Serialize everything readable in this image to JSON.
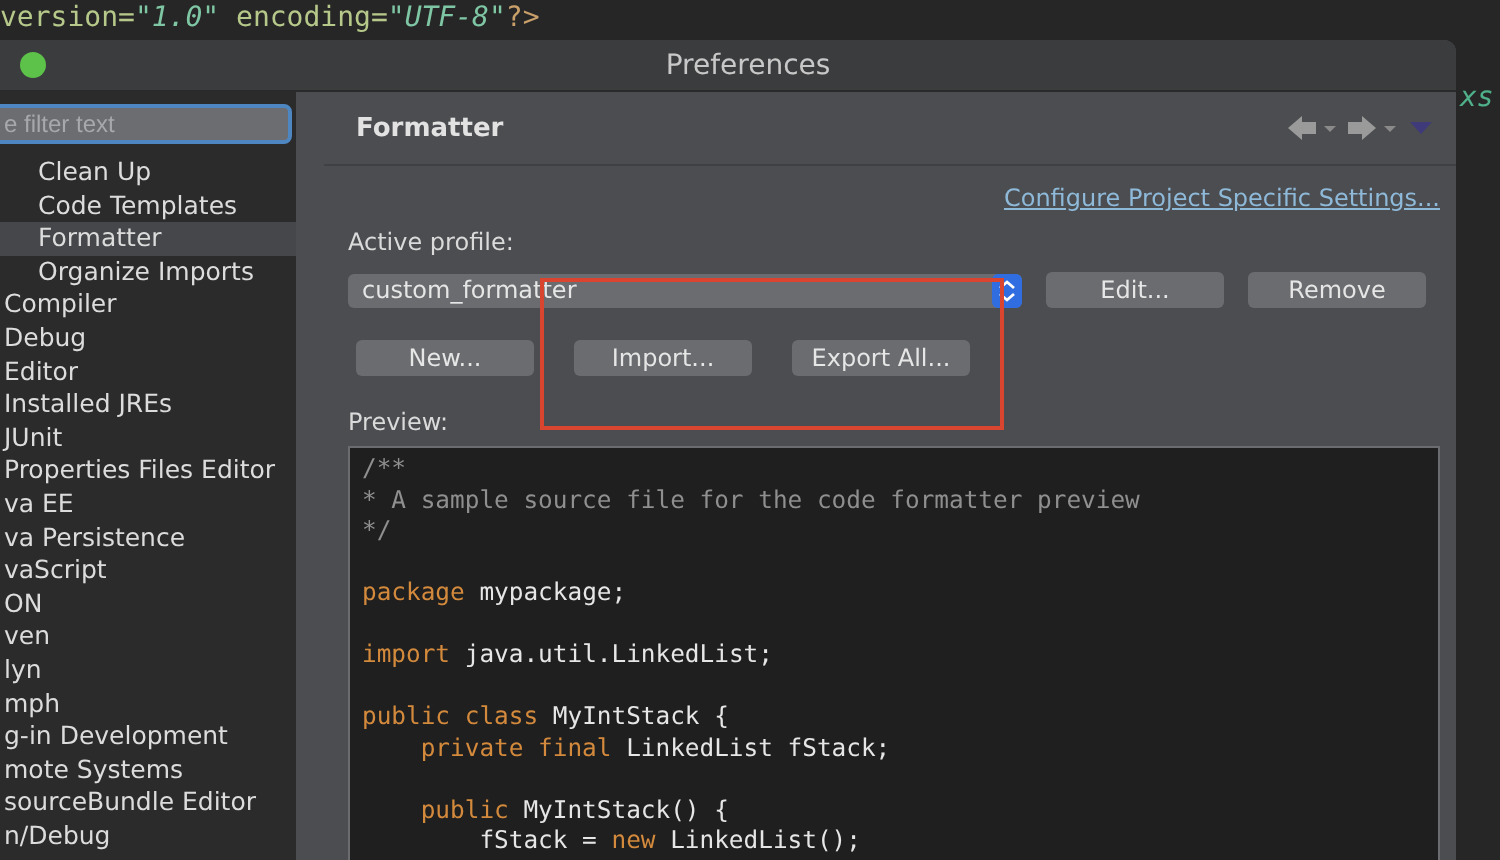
{
  "editor_line": [
    {
      "kind": "attr",
      "text": "version="
    },
    {
      "kind": "string",
      "text": "\"1.0\""
    },
    {
      "kind": "attr",
      "text": " encoding="
    },
    {
      "kind": "string",
      "text": "\"UTF-8\""
    },
    {
      "kind": "tag",
      "text": "?>"
    }
  ],
  "editor_side_text": "xs",
  "window": {
    "title": "Preferences"
  },
  "sidebar": {
    "filter": {
      "placeholder": "e filter text"
    },
    "subitems": [
      {
        "label": "Clean Up",
        "selected": false
      },
      {
        "label": "Code Templates",
        "selected": false
      },
      {
        "label": "Formatter",
        "selected": true
      },
      {
        "label": "Organize Imports",
        "selected": false
      }
    ],
    "items": [
      "Compiler",
      "Debug",
      "Editor",
      "Installed JREs",
      "JUnit",
      "Properties Files Editor",
      "va EE",
      "va Persistence",
      "vaScript",
      "ON",
      "ven",
      "lyn",
      "mph",
      "g-in Development",
      "mote Systems",
      "sourceBundle Editor",
      "n/Debug"
    ]
  },
  "page": {
    "title": "Formatter",
    "link": "Configure Project Specific Settings...",
    "profile_label": "Active profile:",
    "profile_value": "custom_formatter",
    "side_buttons": [
      "Edit...",
      "Remove"
    ],
    "buttons": [
      "New...",
      "Import...",
      "Export All..."
    ],
    "preview_label": "Preview:",
    "code": [
      {
        "kind": "top",
        "tokens": [
          {
            "kind": "comment",
            "text": "/**"
          }
        ]
      },
      {
        "kind": "top",
        "tokens": [
          {
            "kind": "comment",
            "text": "* A sample source file for the code formatter preview"
          }
        ]
      },
      {
        "kind": "top",
        "tokens": [
          {
            "kind": "comment",
            "text": "*/"
          }
        ]
      },
      {
        "kind": "blank"
      },
      {
        "kind": "top",
        "tokens": [
          {
            "kind": "keyword",
            "text": "package"
          },
          {
            "kind": "plain",
            "text": " mypackage;"
          }
        ]
      },
      {
        "kind": "blank"
      },
      {
        "kind": "top",
        "tokens": [
          {
            "kind": "keyword",
            "text": "import"
          },
          {
            "kind": "plain",
            "text": " java.util.LinkedList;"
          }
        ]
      },
      {
        "kind": "blank"
      },
      {
        "kind": "top",
        "tokens": [
          {
            "kind": "keyword",
            "text": "public class"
          },
          {
            "kind": "plain",
            "text": " MyIntStack {"
          }
        ]
      },
      {
        "kind": "member",
        "tokens": [
          {
            "kind": "keyword",
            "text": "private final"
          },
          {
            "kind": "plain",
            "text": " LinkedList fStack;"
          }
        ]
      },
      {
        "kind": "blank"
      },
      {
        "kind": "member",
        "tokens": [
          {
            "kind": "keyword",
            "text": "public"
          },
          {
            "kind": "plain",
            "text": " MyIntStack() {"
          }
        ]
      },
      {
        "kind": "body",
        "tokens": [
          {
            "kind": "plain",
            "text": "fStack = "
          },
          {
            "kind": "keyword",
            "text": "new"
          },
          {
            "kind": "plain",
            "text": " LinkedList();"
          }
        ]
      }
    ]
  }
}
